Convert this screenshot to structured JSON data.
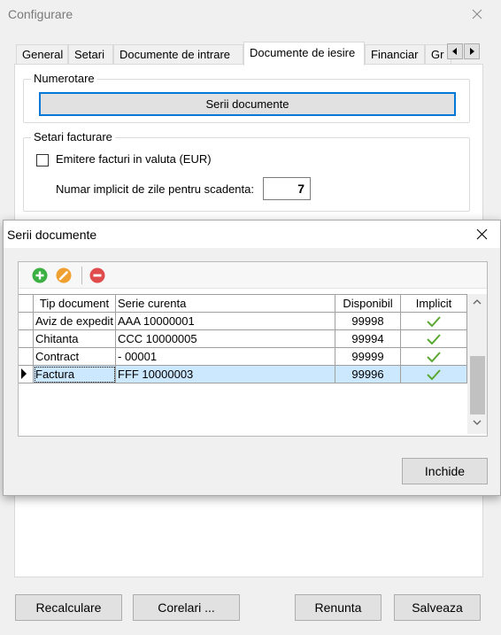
{
  "main_window": {
    "title": "Configurare",
    "tabs": [
      {
        "label": "General"
      },
      {
        "label": "Setari"
      },
      {
        "label": "Documente de intrare"
      },
      {
        "label": "Documente de iesire"
      },
      {
        "label": "Financiar"
      },
      {
        "label": "Gr"
      }
    ],
    "active_tab": "Documente de iesire",
    "numerotare": {
      "legend": "Numerotare",
      "serii_button": "Serii documente"
    },
    "setari_facturare": {
      "legend": "Setari facturare",
      "currency_checkbox_label": "Emitere facturi in valuta (EUR)",
      "currency_checked": false,
      "days_label": "Numar implicit de zile pentru scadenta:",
      "days_value": "7"
    },
    "bottom_buttons": {
      "recalculare": "Recalculare",
      "corelari": "Corelari ...",
      "renunta": "Renunta",
      "salveaza": "Salveaza"
    }
  },
  "dialog": {
    "title": "Serii documente",
    "toolbar": {
      "icons": [
        "add-icon",
        "edit-icon",
        "delete-icon"
      ],
      "colors": {
        "add": "#3cb043",
        "edit": "#f0a030",
        "delete": "#e04b4b"
      }
    },
    "grid": {
      "columns": [
        "Tip document",
        "Serie curenta",
        "Disponibil",
        "Implicit"
      ],
      "rows": [
        {
          "tip": "Aviz de expedit",
          "serie": "AAA 10000001",
          "disponibil": "99998",
          "implicit": true
        },
        {
          "tip": "Chitanta",
          "serie": "CCC 10000005",
          "disponibil": "99994",
          "implicit": true
        },
        {
          "tip": "Contract",
          "serie": "- 00001",
          "disponibil": "99999",
          "implicit": true
        },
        {
          "tip": "Factura",
          "serie": "FFF 10000003",
          "disponibil": "99996",
          "implicit": true
        }
      ],
      "selected_row": 3,
      "selection_color": "#cce8ff",
      "check_color": "#5aa832"
    },
    "close_button": "Inchide"
  }
}
